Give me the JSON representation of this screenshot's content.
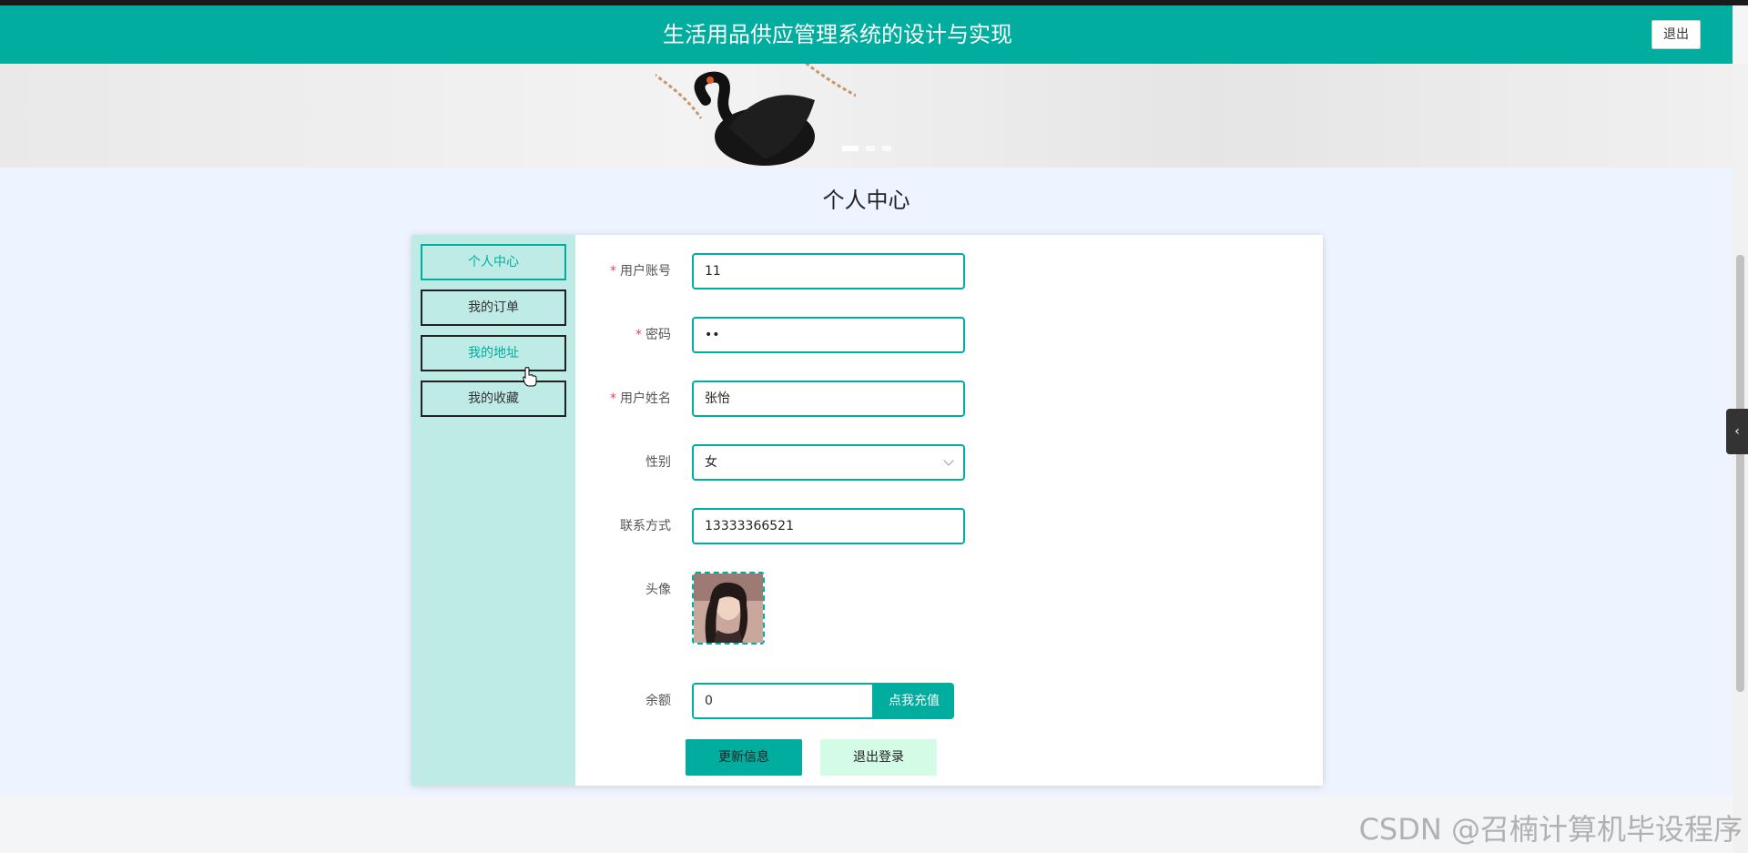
{
  "header": {
    "title": "生活用品供应管理系统的设计与实现",
    "logout_label": "退出"
  },
  "page": {
    "heading": "个人中心"
  },
  "sidebar": {
    "items": [
      {
        "label": "个人中心"
      },
      {
        "label": "我的订单"
      },
      {
        "label": "我的地址"
      },
      {
        "label": "我的收藏"
      }
    ]
  },
  "form": {
    "username": {
      "label": "用户账号",
      "value": "11"
    },
    "password": {
      "label": "密码",
      "value": "••"
    },
    "realname": {
      "label": "用户姓名",
      "value": "张怡"
    },
    "gender": {
      "label": "性别",
      "value": "女"
    },
    "phone": {
      "label": "联系方式",
      "value": "13333366521"
    },
    "avatar": {
      "label": "头像"
    },
    "balance": {
      "label": "余额",
      "value": "0",
      "recharge_label": "点我充值"
    },
    "update_label": "更新信息",
    "logout_label": "退出登录"
  },
  "watermark": "CSDN @召楠计算机毕设程序",
  "colors": {
    "primary": "#00ad9f",
    "sidebar_bg": "#bfebe7",
    "content_bg": "#edf4ff",
    "logout_btn_bg": "#d3fbe6"
  }
}
